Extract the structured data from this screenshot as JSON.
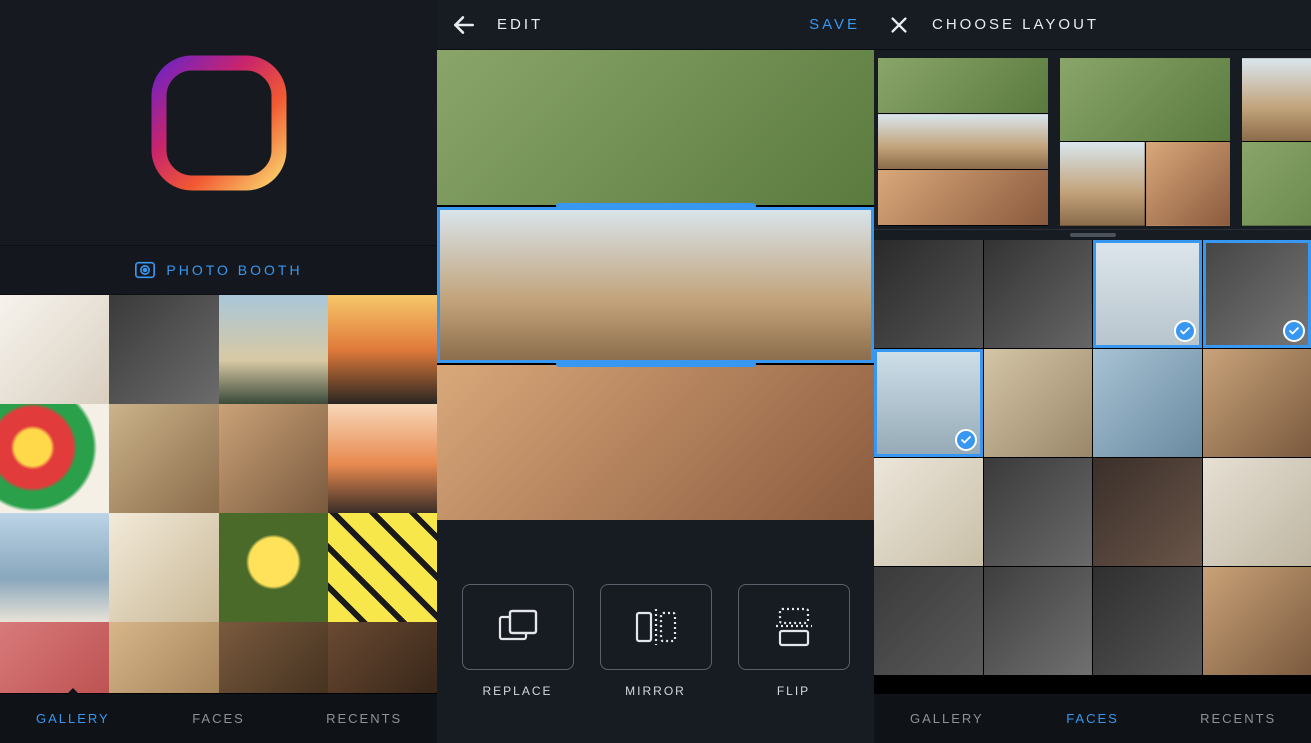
{
  "pane1": {
    "photo_booth_label": "PHOTO BOOTH",
    "tabs": [
      {
        "label": "GALLERY",
        "active": true
      },
      {
        "label": "FACES",
        "active": false
      },
      {
        "label": "RECENTS",
        "active": false
      }
    ],
    "thumbs": [
      "ph0",
      "ph1",
      "ph2",
      "ph3",
      "ph4",
      "ph5",
      "ph6",
      "ph7",
      "ph8",
      "ph9",
      "ph10",
      "ph11",
      "ph12",
      "ph13",
      "ph14",
      "ph15"
    ]
  },
  "pane2": {
    "title": "EDIT",
    "save_label": "SAVE",
    "selected_row_index": 1,
    "tools": [
      {
        "label": "REPLACE",
        "id": "replace"
      },
      {
        "label": "MIRROR",
        "id": "mirror"
      },
      {
        "label": "FLIP",
        "id": "flip"
      }
    ]
  },
  "pane3": {
    "title": "CHOOSE LAYOUT",
    "tabs": [
      {
        "label": "GALLERY",
        "active": false
      },
      {
        "label": "FACES",
        "active": true
      },
      {
        "label": "RECENTS",
        "active": false
      }
    ],
    "selected_thumb_indices": [
      2,
      3,
      4
    ],
    "thumbs": [
      "fA",
      "fB",
      "fC",
      "fD",
      "fE",
      "fF",
      "fG",
      "fH",
      "fI",
      "fJ",
      "fK",
      "fL",
      "fM",
      "fN",
      "fO",
      "fP"
    ]
  }
}
